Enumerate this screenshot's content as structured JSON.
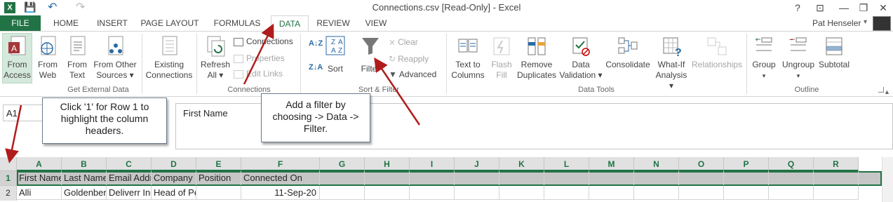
{
  "window": {
    "title": "Connections.csv  [Read-Only] - Excel",
    "qat_save": "💾",
    "qat_undo": "↶",
    "qat_redo": "↷",
    "help": "?",
    "ribbon_opts": "⊡",
    "minimize": "—",
    "restore": "❐",
    "close": "✕",
    "user": "Pat Henseler",
    "user_caret": "▾"
  },
  "tabs": [
    "FILE",
    "HOME",
    "INSERT",
    "PAGE LAYOUT",
    "FORMULAS",
    "DATA",
    "REVIEW",
    "VIEW"
  ],
  "active_tab": "DATA",
  "ribbon": {
    "get_external": {
      "from_access": [
        "From",
        "Access"
      ],
      "from_web": [
        "From",
        "Web"
      ],
      "from_text": [
        "From",
        "Text"
      ],
      "from_other": [
        "From Other",
        "Sources ▾"
      ],
      "existing": [
        "Existing",
        "Connections"
      ],
      "label": "Get External Data"
    },
    "connections": {
      "refresh": [
        "Refresh",
        "All ▾"
      ],
      "connections": "Connections",
      "properties": "Properties",
      "edit_links": "Edit Links",
      "label": "Connections"
    },
    "sort_filter": {
      "sort_az": "A↓Z",
      "sort_za": "Z↓A",
      "sort": "Sort",
      "filter": "Filter",
      "clear": "Clear",
      "reapply": "Reapply",
      "advanced": "Advanced",
      "label": "Sort & Filter"
    },
    "data_tools": {
      "text_to_columns": [
        "Text to",
        "Columns"
      ],
      "flash_fill": [
        "Flash",
        "Fill"
      ],
      "remove_duplicates": [
        "Remove",
        "Duplicates"
      ],
      "data_validation": [
        "Data",
        "Validation ▾"
      ],
      "consolidate": "Consolidate",
      "what_if": [
        "What-If",
        "Analysis ▾"
      ],
      "relationships": "Relationships",
      "label": "Data Tools"
    },
    "outline": {
      "group": [
        "Group",
        "▾"
      ],
      "ungroup": [
        "Ungroup",
        "▾"
      ],
      "subtotal": "Subtotal",
      "label": "Outline"
    }
  },
  "name_box": "A1",
  "formula_content": "First Name",
  "columns": [
    "A",
    "B",
    "C",
    "D",
    "E",
    "F",
    "G",
    "H",
    "I",
    "J",
    "K",
    "L",
    "M",
    "N",
    "O",
    "P",
    "Q",
    "R"
  ],
  "rows": [
    {
      "num": "1",
      "cells": [
        "First Name",
        "Last Name",
        "Email Address",
        "Company",
        "Position",
        "Connected On"
      ]
    },
    {
      "num": "2",
      "cells": [
        "Alli",
        "Goldenberg (She/Her)",
        "Deliverr Inc",
        "Head of People",
        "",
        "11-Sep-20"
      ]
    }
  ],
  "callouts": {
    "row_hint": "Click '1' for Row 1 to highlight  the column headers.",
    "filter_hint": "Add a filter by choosing -> Data -> Filter."
  },
  "colors": {
    "accent": "#217346",
    "arrow": "#b01c1c",
    "row_highlight": "#c6c6c6"
  }
}
